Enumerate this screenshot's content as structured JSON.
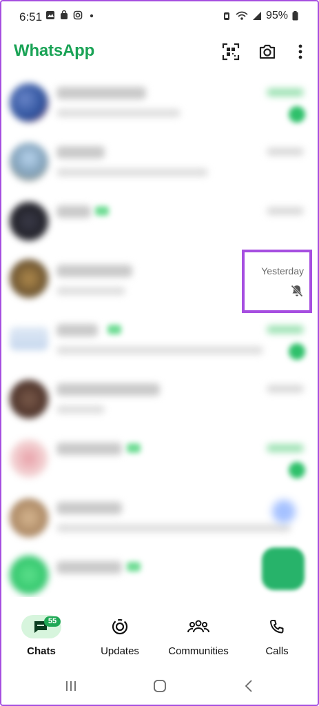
{
  "status_bar": {
    "time": "6:51",
    "battery": "95%",
    "left_icons": [
      "image-icon",
      "shopping-bag-icon",
      "instagram-icon",
      "dot-icon"
    ],
    "right_icons": [
      "alarm-icon",
      "wifi-icon",
      "signal-icon",
      "battery-icon"
    ]
  },
  "header": {
    "title": "WhatsApp",
    "brand_color": "#1aa356",
    "actions": [
      "qr-scanner-icon",
      "camera-icon",
      "more-options-icon"
    ]
  },
  "chats": {
    "highlighted_row": {
      "time": "Yesterday",
      "status_icon": "muted-bell-icon"
    },
    "highlight_color": "#a64ee0"
  },
  "bottom_nav": {
    "tabs": [
      {
        "label": "Chats",
        "icon": "chats-icon",
        "badge": "55",
        "active": true
      },
      {
        "label": "Updates",
        "icon": "updates-icon"
      },
      {
        "label": "Communities",
        "icon": "communities-icon"
      },
      {
        "label": "Calls",
        "icon": "phone-icon"
      }
    ],
    "active_pill_color": "#d7f5dd"
  },
  "system_nav": [
    "recent-apps-icon",
    "home-icon",
    "back-icon"
  ]
}
